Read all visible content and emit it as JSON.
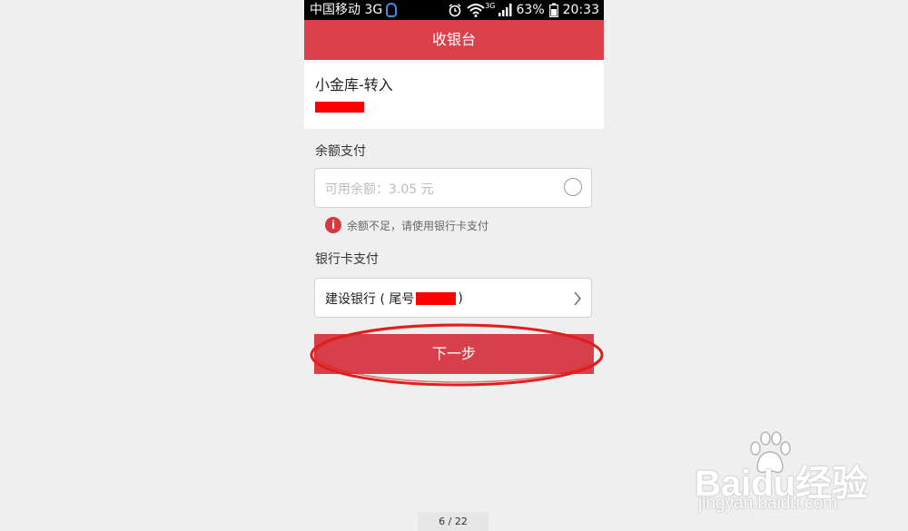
{
  "status_bar": {
    "carrier": "中国移动 3G",
    "battery": "63%",
    "time": "20:33",
    "network_tag": "3G"
  },
  "header": {
    "title": "收银台"
  },
  "product": {
    "title": "小金库-转入"
  },
  "balance_section": {
    "label": "余额支付",
    "available_text": "可用余额：3.05 元",
    "warning": "余额不足，请使用银行卡支付"
  },
  "bank_section": {
    "label": "银行卡支付",
    "bank_prefix": "建设银行 ( 尾号",
    "bank_suffix": ")"
  },
  "actions": {
    "next_label": "下一步"
  },
  "pagination": {
    "text": "6 / 22"
  },
  "watermark": {
    "logo": "Baidu经验",
    "url": "jingyan.baidu.com"
  },
  "colors": {
    "brand_red": "#dc414b",
    "warning_red": "#d7393f",
    "annotation_red": "#e01e1e"
  },
  "icons": [
    "qq-icon",
    "alarm-icon",
    "wifi-icon",
    "signal-icon",
    "battery-icon",
    "info-icon",
    "chevron-right-icon",
    "paw-icon"
  ]
}
